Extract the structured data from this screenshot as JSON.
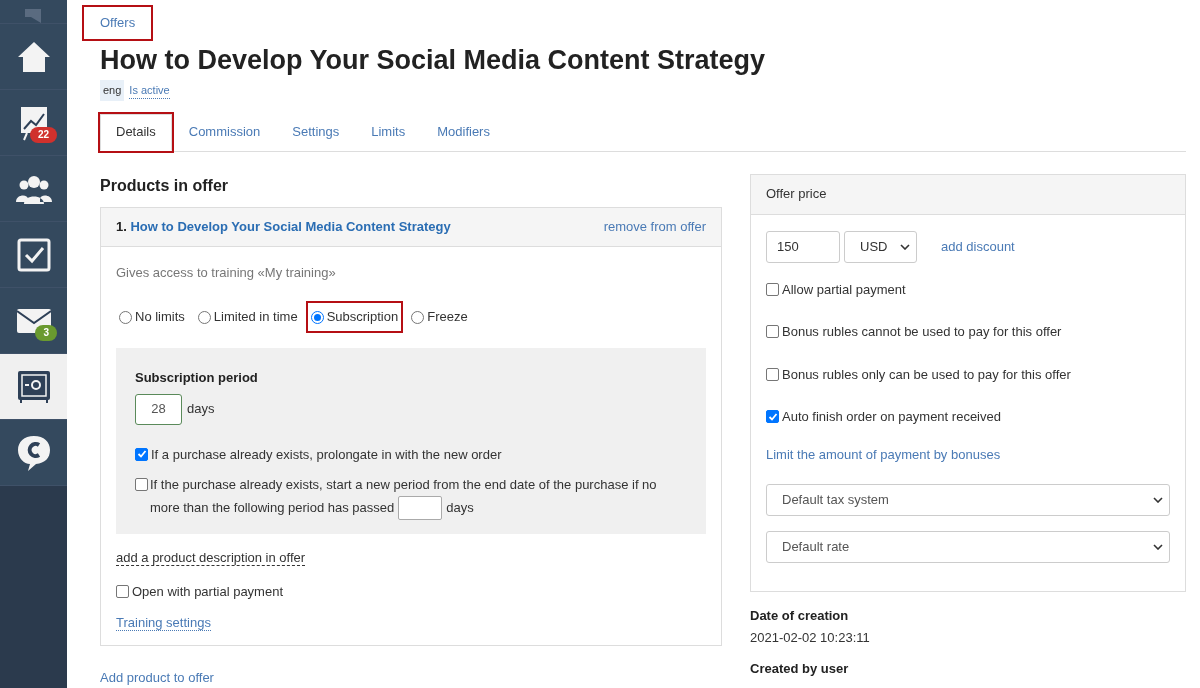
{
  "sidebar": {
    "items": [
      {
        "kind": "megaphone",
        "selected": false
      },
      {
        "kind": "home",
        "selected": false
      },
      {
        "kind": "chart",
        "selected": false,
        "badge": "22",
        "color": "#d0312d"
      },
      {
        "kind": "users",
        "selected": false
      },
      {
        "kind": "tasks",
        "selected": false
      },
      {
        "kind": "mail",
        "selected": false,
        "badge": "3",
        "color": "#6a9a2f"
      },
      {
        "kind": "safe",
        "selected": true
      },
      {
        "kind": "chat",
        "selected": false
      }
    ]
  },
  "breadcrumb": {
    "label": "Offers",
    "highlighted": true
  },
  "title": "How to Develop Your Social Media Content Strategy",
  "language_tag": "eng",
  "status_link": "Is active",
  "tabs": [
    {
      "label": "Details",
      "selected": true,
      "highlighted": true
    },
    {
      "label": "Commission",
      "selected": false,
      "highlighted": false
    },
    {
      "label": "Settings",
      "selected": false,
      "highlighted": false
    },
    {
      "label": "Limits",
      "selected": false,
      "highlighted": false
    },
    {
      "label": "Modifiers",
      "selected": false,
      "highlighted": false
    }
  ],
  "products": {
    "heading": "Products in offer",
    "items": [
      {
        "number": "1.",
        "name": "How to Develop Your Social Media Content Strategy",
        "remove": "remove from offer",
        "access": "Gives access to training «My training»",
        "limit_options": [
          {
            "label": "No limits",
            "selected": false,
            "highlighted": false
          },
          {
            "label": "Limited in time",
            "selected": false,
            "highlighted": false
          },
          {
            "label": "Subscription",
            "selected": true,
            "highlighted": true
          },
          {
            "label": "Freeze",
            "selected": false,
            "highlighted": false
          }
        ],
        "subscription": {
          "heading": "Subscription period",
          "period": "28",
          "unit": "days",
          "prolong": {
            "label": "If a purchase already exists, prolongate in with the new order",
            "checked": true
          },
          "restart": {
            "label_line1": "If the purchase already exists, start a new period from the end date of the purchase if no",
            "label_line2": "more than the following period has passed",
            "unit": "days",
            "checked": false
          }
        },
        "description_link": "add a product description in offer",
        "partial": {
          "label": "Open with partial payment",
          "checked": false
        },
        "training_settings": "Training settings"
      }
    ],
    "add_link": "Add product to offer"
  },
  "price": {
    "heading": "Offer price",
    "amount": "150",
    "currency": "USD",
    "discount_link": "add discount",
    "options": [
      {
        "label": "Allow partial payment",
        "checked": false
      },
      {
        "label": "Bonus rubles cannot be used to pay for this offer",
        "checked": false
      },
      {
        "label": "Bonus rubles only can be used to pay for this offer",
        "checked": false
      },
      {
        "label": "Auto finish order on payment received",
        "checked": true
      }
    ],
    "limit_link": "Limit the amount of payment by bonuses",
    "tax_system": "Default tax system",
    "rate": "Default rate"
  },
  "info": [
    {
      "label": "Date of creation",
      "value": "2021-02-02 10:23:11"
    },
    {
      "label": "Created by user"
    }
  ]
}
